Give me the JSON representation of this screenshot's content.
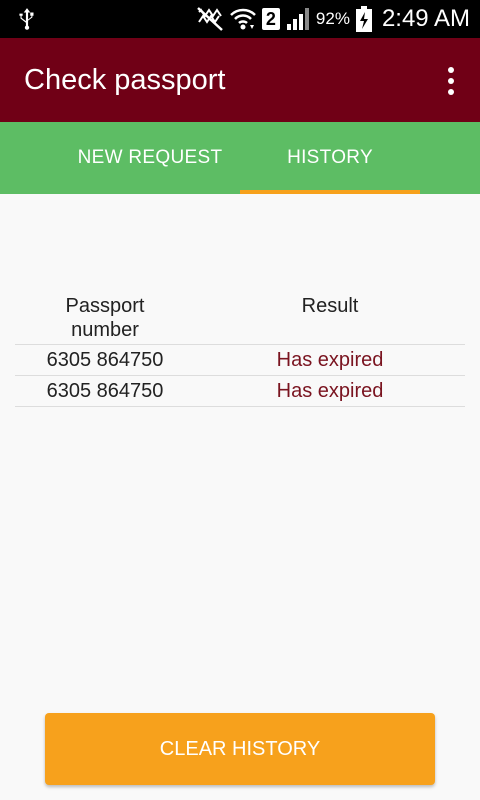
{
  "status_bar": {
    "icons": [
      "usb-icon",
      "mute-icon",
      "wifi-icon",
      "sim-icon",
      "signal-icon",
      "battery-charging-icon"
    ],
    "sim_number": "2",
    "battery_percent": "92%",
    "time": "2:49 AM"
  },
  "app_bar": {
    "title": "Check passport",
    "menu_icon": "more-vert-icon"
  },
  "tabs": [
    {
      "label": "NEW REQUEST",
      "selected": false
    },
    {
      "label": "HISTORY",
      "selected": true
    }
  ],
  "history": {
    "headers": {
      "passport_line1": "Passport",
      "passport_line2": "number",
      "result": "Result"
    },
    "rows": [
      {
        "passport_number": "6305 864750",
        "result": "Has expired"
      },
      {
        "passport_number": "6305 864750",
        "result": "Has expired"
      }
    ]
  },
  "clear_button_label": "CLEAR HISTORY",
  "colors": {
    "app_bar": "#700016",
    "tab_bar": "#5dbd64",
    "accent": "#f7a11c",
    "result_text": "#7a1420"
  }
}
